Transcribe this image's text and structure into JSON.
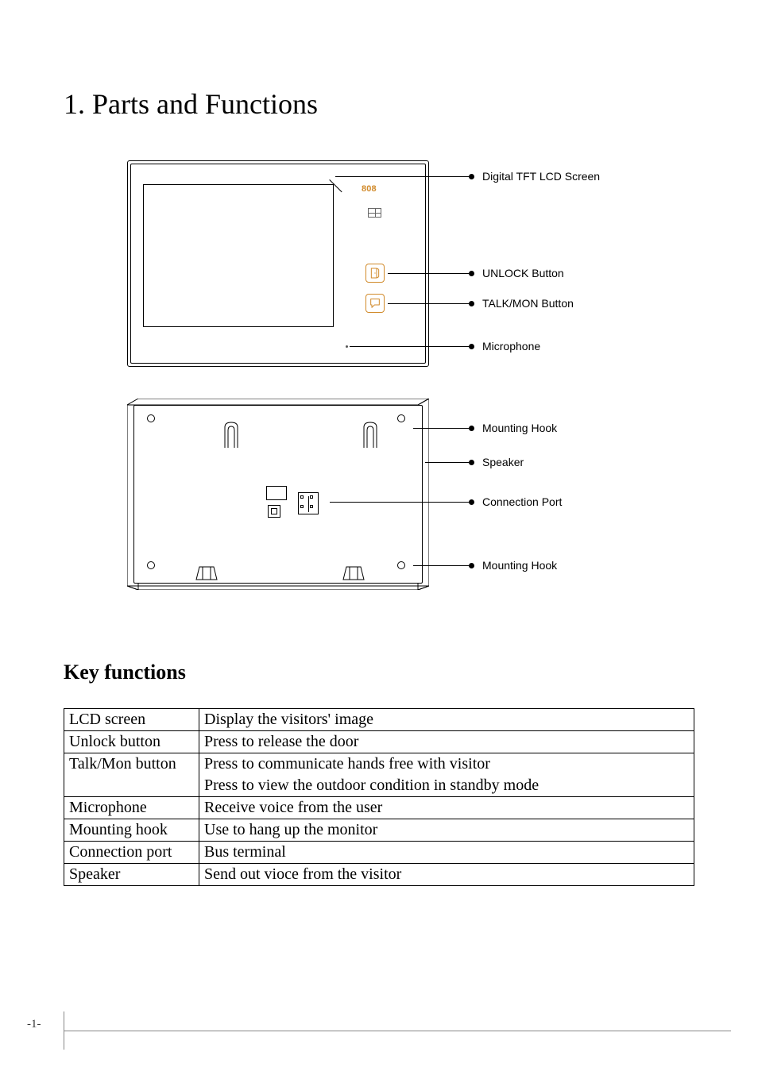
{
  "title": "1. Parts and Functions",
  "subtitle": "Key functions",
  "front_logo": "808",
  "callouts": {
    "screen": "Digital TFT LCD Screen",
    "unlock": "UNLOCK Button",
    "talk": "TALK/MON Button",
    "mic": "Microphone",
    "mount_top": "Mounting Hook",
    "speaker": "Speaker",
    "port": "Connection Port",
    "mount_bottom": "Mounting Hook"
  },
  "table": {
    "rows": [
      {
        "name": "LCD screen",
        "desc": "Display the visitors' image"
      },
      {
        "name": "Unlock button",
        "desc": "Press to release the door"
      },
      {
        "name": "Talk/Mon button",
        "desc": "Press to communicate hands free with visitor\nPress to view the outdoor condition in standby mode"
      },
      {
        "name": "Microphone",
        "desc": "Receive voice from the user"
      },
      {
        "name": "Mounting hook",
        "desc": "Use to hang up the monitor"
      },
      {
        "name": "Connection port",
        "desc": "Bus terminal"
      },
      {
        "name": "Speaker",
        "desc": "Send out vioce from the visitor"
      }
    ]
  },
  "page_number": "-1-"
}
